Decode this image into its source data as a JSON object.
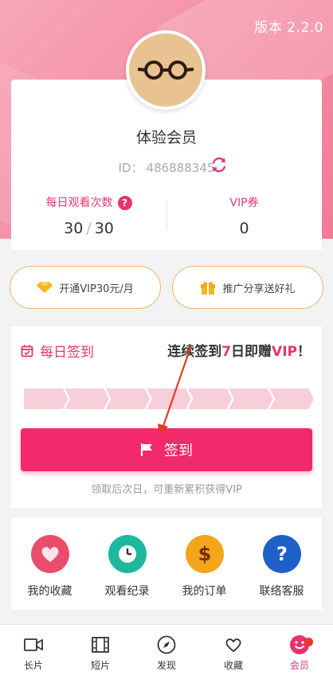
{
  "header": {
    "version": "版本 2.2.0"
  },
  "user": {
    "name": "体验会员",
    "id_label": "ID：",
    "id_value": "486888345"
  },
  "stats": {
    "views": {
      "title": "每日观看次数",
      "used": "30",
      "sep": "/",
      "total": "30"
    },
    "vip": {
      "title": "VIP券",
      "value": "0"
    }
  },
  "promo": {
    "open_vip": "开通VIP30元/月",
    "share": "推广分享送好礼"
  },
  "checkin": {
    "title": "每日签到",
    "promo_prefix": "连续签到",
    "promo_days": "7",
    "promo_mid": "日即赠",
    "promo_vip": "VIP",
    "promo_suffix": "！",
    "button": "签到",
    "note": "领取后次日，可重新累积获得VIP",
    "progress_days_total": 7,
    "progress_days_done": 0
  },
  "actions": [
    {
      "label": "我的收藏",
      "icon": "heart-icon",
      "color": "#e94d6b"
    },
    {
      "label": "观看纪录",
      "icon": "clock-icon",
      "color": "#1fb89c"
    },
    {
      "label": "我的订单",
      "icon": "dollar-icon",
      "color": "#f3a51b"
    },
    {
      "label": "联络客服",
      "icon": "question-icon",
      "color": "#1f5fc8"
    }
  ],
  "tabs": [
    {
      "label": "长片",
      "icon": "video-icon"
    },
    {
      "label": "短片",
      "icon": "film-icon"
    },
    {
      "label": "发现",
      "icon": "compass-icon"
    },
    {
      "label": "收藏",
      "icon": "heart-outline-icon"
    },
    {
      "label": "会员",
      "icon": "smile-icon",
      "active": true
    }
  ],
  "colors": {
    "accent": "#e8336e",
    "button": "#f2296a",
    "header": "#f48aa2"
  }
}
